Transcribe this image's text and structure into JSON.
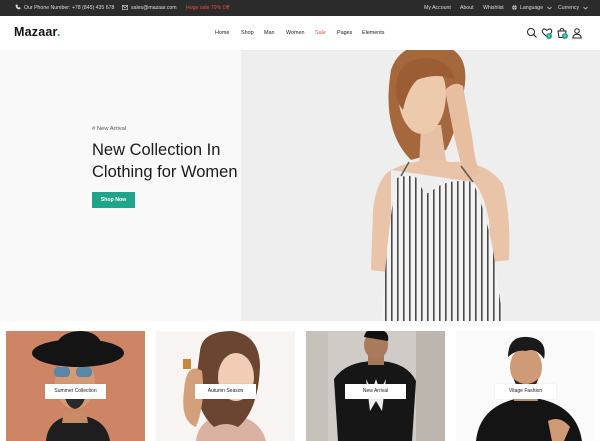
{
  "topbar": {
    "phone": "Our Phone Number: +78 (845) 435 678",
    "email": "sales@mazaar.com",
    "promo": "Huge sale 70% Off",
    "my_account": "My Account",
    "about": "About",
    "wishlist": "Whishlist",
    "language": "Language",
    "currency": "Currency"
  },
  "brand": {
    "name": "Mazaar",
    "dot": ".",
    "accent": "#20a58a",
    "sale_color": "#e8533f"
  },
  "nav": {
    "items": [
      "Home",
      "Shop",
      "Man",
      "Women",
      "Sale",
      "Pages",
      "Elements"
    ]
  },
  "header_icons": {
    "search": "search-icon",
    "wishlist": "heart-icon",
    "wishlist_count": "0",
    "cart": "cart-icon",
    "cart_count": "0",
    "account": "user-icon"
  },
  "hero": {
    "eyebrow": "# New Arrival",
    "title_line1": "New Collection In",
    "title_line2": "Clothing for Women",
    "button": "Shop Now"
  },
  "categories": [
    {
      "label": "Summer Collection"
    },
    {
      "label": "Autumn Season"
    },
    {
      "label": "New Arrival"
    },
    {
      "label": "Vitage Fashion"
    }
  ]
}
